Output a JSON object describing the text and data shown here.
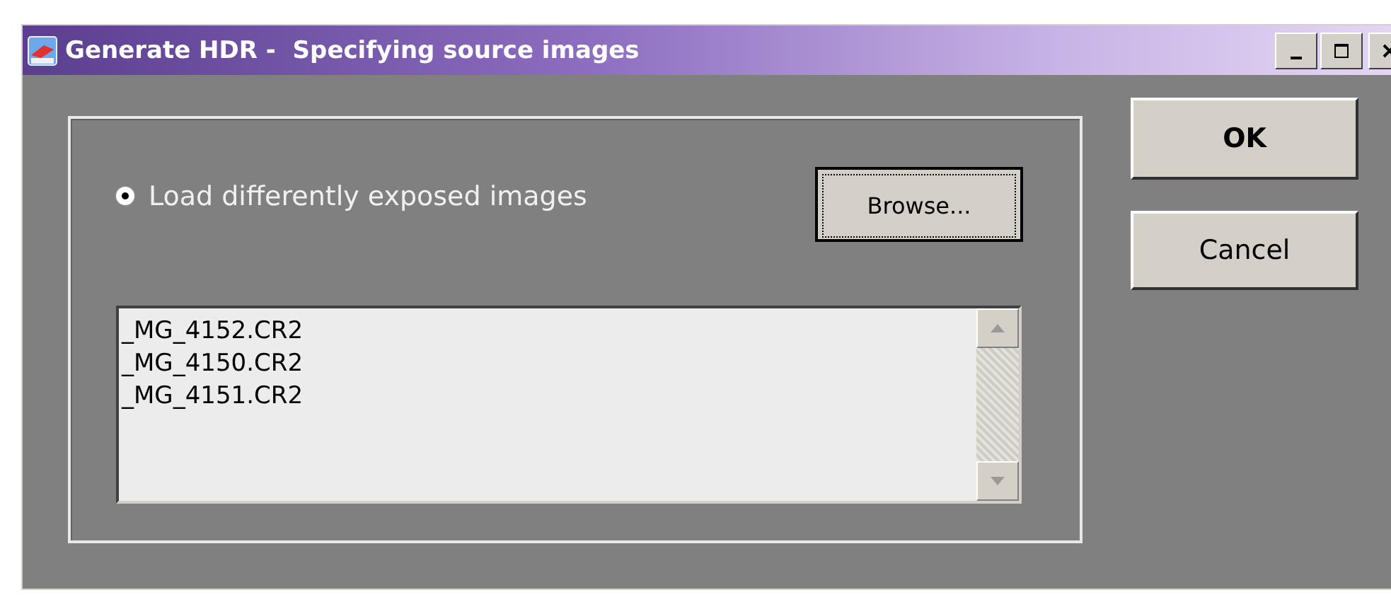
{
  "window": {
    "title": "Generate HDR -  Specifying source images"
  },
  "source_option": {
    "label": "Load differently exposed images",
    "selected": true
  },
  "browse_button": {
    "label": "Browse..."
  },
  "file_list": {
    "items": [
      "_MG_4152.CR2",
      "_MG_4150.CR2",
      "_MG_4151.CR2"
    ]
  },
  "buttons": [
    {
      "label": "OK",
      "default": true
    },
    {
      "label": "Cancel",
      "default": false
    }
  ]
}
